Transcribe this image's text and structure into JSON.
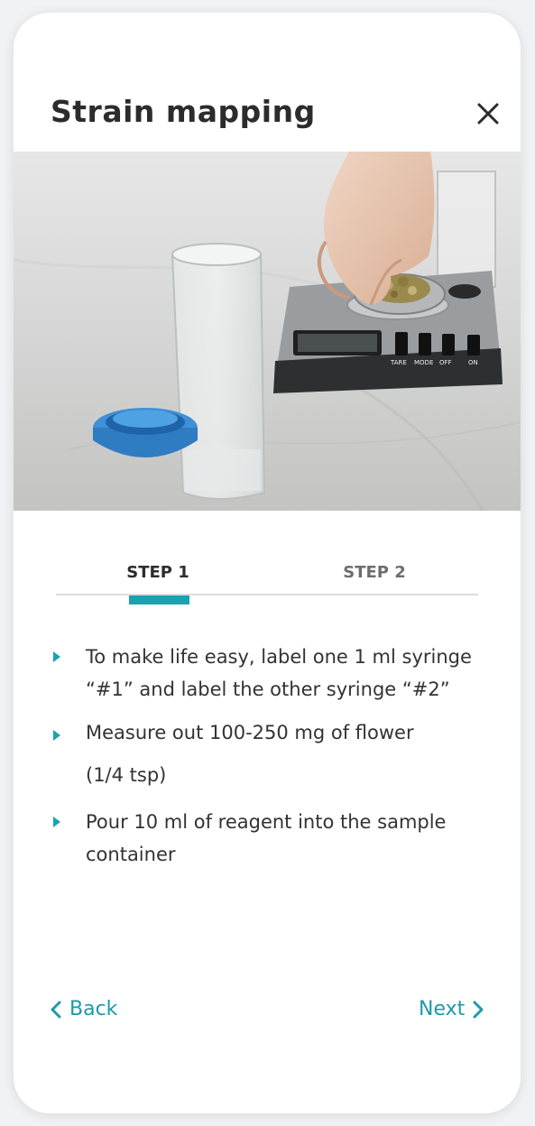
{
  "header": {
    "title": "Strain mapping",
    "close_icon": "close-icon"
  },
  "tabs": [
    {
      "label": "STEP 1",
      "active": true
    },
    {
      "label": "STEP 2",
      "active": false
    }
  ],
  "steps": [
    {
      "lines": [
        "To make life easy, label one 1 ml syringe",
        "“#1” and label the other syringe “#2”"
      ]
    },
    {
      "lines": [
        "Measure out 100-250 mg of flower",
        "(1/4 tsp)"
      ]
    },
    {
      "lines": [
        "Pour 10 ml of reagent into the sample",
        "container"
      ]
    }
  ],
  "scale_labels": [
    "TARE",
    "MODE",
    "OFF",
    "ON"
  ],
  "navigation": {
    "back_label": "Back",
    "next_label": "Next",
    "back_icon": "chevron-left-icon",
    "next_icon": "chevron-right-icon"
  },
  "colors": {
    "accent": "#1ba2b1",
    "text": "#2c2c2c",
    "inactive_tab": "#6d6d70"
  }
}
